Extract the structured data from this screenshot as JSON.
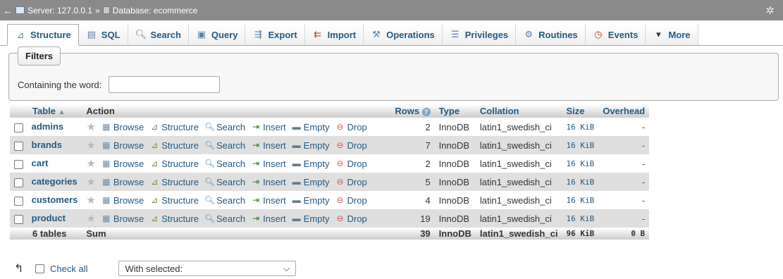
{
  "breadcrumb": {
    "server": "Server: 127.0.0.1",
    "sep": "»",
    "database": "Database: ecommerce"
  },
  "tabs": [
    {
      "label": "Structure",
      "icon": "structure-icon"
    },
    {
      "label": "SQL",
      "icon": "sql-icon"
    },
    {
      "label": "Search",
      "icon": "search-icon"
    },
    {
      "label": "Query",
      "icon": "query-icon"
    },
    {
      "label": "Export",
      "icon": "export-icon"
    },
    {
      "label": "Import",
      "icon": "import-icon"
    },
    {
      "label": "Operations",
      "icon": "wrench-icon"
    },
    {
      "label": "Privileges",
      "icon": "privileges-icon"
    },
    {
      "label": "Routines",
      "icon": "routines-icon"
    },
    {
      "label": "Events",
      "icon": "events-icon"
    },
    {
      "label": "More",
      "icon": "caret-down-icon"
    }
  ],
  "filters": {
    "legend": "Filters",
    "label": "Containing the word:",
    "value": ""
  },
  "table_headers": {
    "table": "Table",
    "action": "Action",
    "rows": "Rows",
    "type": "Type",
    "collation": "Collation",
    "size": "Size",
    "overhead": "Overhead"
  },
  "actions": {
    "browse": "Browse",
    "structure": "Structure",
    "search": "Search",
    "insert": "Insert",
    "empty": "Empty",
    "drop": "Drop"
  },
  "rows": [
    {
      "name": "admins",
      "rows": "2",
      "type": "InnoDB",
      "collation": "latin1_swedish_ci",
      "size": "16 KiB",
      "overhead": "-"
    },
    {
      "name": "brands",
      "rows": "7",
      "type": "InnoDB",
      "collation": "latin1_swedish_ci",
      "size": "16 KiB",
      "overhead": "-"
    },
    {
      "name": "cart",
      "rows": "2",
      "type": "InnoDB",
      "collation": "latin1_swedish_ci",
      "size": "16 KiB",
      "overhead": "-"
    },
    {
      "name": "categories",
      "rows": "5",
      "type": "InnoDB",
      "collation": "latin1_swedish_ci",
      "size": "16 KiB",
      "overhead": "-"
    },
    {
      "name": "customers",
      "rows": "4",
      "type": "InnoDB",
      "collation": "latin1_swedish_ci",
      "size": "16 KiB",
      "overhead": "-"
    },
    {
      "name": "product",
      "rows": "19",
      "type": "InnoDB",
      "collation": "latin1_swedish_ci",
      "size": "16 KiB",
      "overhead": "-"
    }
  ],
  "footer": {
    "count": "6 tables",
    "sum": "Sum",
    "rows": "39",
    "type": "InnoDB",
    "collation": "latin1_swedish_ci",
    "size": "96 KiB",
    "overhead": "0 B"
  },
  "bottom": {
    "check_all": "Check all",
    "with_selected": "With selected:"
  }
}
